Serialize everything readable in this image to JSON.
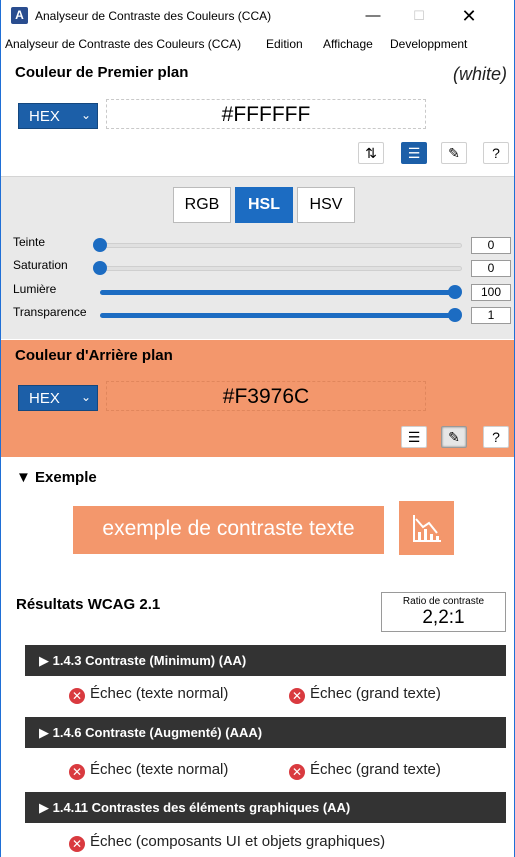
{
  "window": {
    "title": "Analyseur de Contraste des Couleurs (CCA)",
    "minimize": "—",
    "maximize": "☐",
    "close": "✕"
  },
  "menu": {
    "items": [
      "Analyseur de Contraste des Couleurs (CCA)",
      "Edition",
      "Affichage",
      "Developpment"
    ]
  },
  "foreground": {
    "heading": "Couleur de Premier plan",
    "name": "(white)",
    "format": "HEX",
    "value": "#FFFFFF",
    "tools": {
      "swap": "⇅",
      "sliders": "☰",
      "picker": "✎",
      "help": "?"
    },
    "tabs": [
      "RGB",
      "HSL",
      "HSV"
    ],
    "selected_tab": "HSL",
    "sliders": [
      {
        "label": "Teinte",
        "value": "0",
        "level": 0
      },
      {
        "label": "Saturation",
        "value": "0",
        "level": 0
      },
      {
        "label": "Lumière",
        "value": "100",
        "level": 1
      },
      {
        "label": "Transparence",
        "value": "1",
        "level": 1
      }
    ]
  },
  "background": {
    "heading": "Couleur d'Arrière plan",
    "format": "HEX",
    "value": "#F3976C",
    "tools": {
      "sliders": "☰",
      "picker": "✎",
      "help": "?"
    }
  },
  "example": {
    "heading": "▼ Exemple",
    "text": "exemple de contraste texte"
  },
  "results": {
    "heading": "Résultats WCAG 2.1",
    "ratio_label": "Ratio de contraste",
    "ratio_value": "2,2:1",
    "criteria": [
      {
        "title": "▶  1.4.3 Contraste (Minimum) (AA)",
        "results": [
          "Échec (texte normal)",
          "Échec (grand texte)"
        ]
      },
      {
        "title": "▶  1.4.6 Contraste (Augmenté) (AAA)",
        "results": [
          "Échec (texte normal)",
          "Échec (grand texte)"
        ]
      },
      {
        "title": "▶  1.4.11 Contrastes des éléments graphiques (AA)",
        "results": [
          "Échec (composants UI et objets graphiques)"
        ]
      }
    ]
  },
  "colors": {
    "accent": "#1c6cc2",
    "background_color": "#f3976c",
    "fail": "#d93a3f",
    "criterion_bar": "#333333"
  }
}
